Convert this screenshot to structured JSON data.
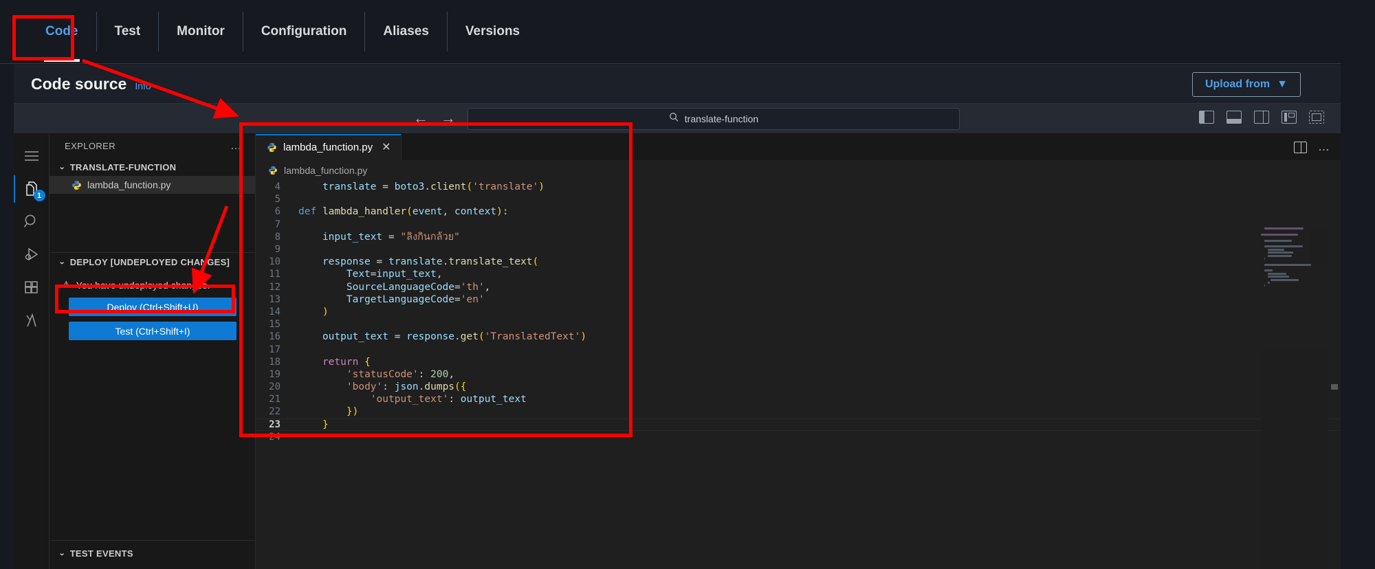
{
  "console": {
    "tabs": [
      {
        "label": "Code",
        "active": true
      },
      {
        "label": "Test",
        "active": false
      },
      {
        "label": "Monitor",
        "active": false
      },
      {
        "label": "Configuration",
        "active": false
      },
      {
        "label": "Aliases",
        "active": false
      },
      {
        "label": "Versions",
        "active": false
      }
    ],
    "section_title": "Code source",
    "info_link": "Info",
    "upload_button": "Upload from",
    "upload_caret": "▼"
  },
  "ide_toolbar": {
    "back_arrow": "←",
    "forward_arrow": "→",
    "quickopen_icon": "search-icon",
    "quickopen_value": "translate-function",
    "layout_icons": [
      "toggle-primary-sidebar-icon",
      "toggle-panel-icon",
      "toggle-secondary-sidebar-icon",
      "customize-layout-icon",
      "fullscreen-icon"
    ]
  },
  "activity_bar": {
    "items": [
      {
        "name": "menu-icon",
        "badge": ""
      },
      {
        "name": "explorer-icon",
        "badge": "1"
      },
      {
        "name": "search-icon",
        "badge": ""
      },
      {
        "name": "run-and-debug-icon",
        "badge": ""
      },
      {
        "name": "extensions-icon",
        "badge": ""
      },
      {
        "name": "lambda-icon",
        "badge": ""
      }
    ]
  },
  "explorer": {
    "title": "EXPLORER",
    "more_actions": "…",
    "project": {
      "chevron": "⌄",
      "name": "TRANSLATE-FUNCTION"
    },
    "files": [
      {
        "name": "lambda_function.py",
        "icon": "python-file-icon",
        "selected": true
      }
    ],
    "deploy": {
      "chevron": "⌄",
      "header": "DEPLOY [UNDEPLOYED CHANGES]",
      "warning_icon": "⚠",
      "warning_text": "You have undeployed changes.",
      "deploy_button": "Deploy (Ctrl+Shift+U)",
      "test_button": "Test (Ctrl+Shift+I)"
    },
    "test_events": {
      "chevron": "⌄",
      "header": "TEST EVENTS"
    }
  },
  "editor": {
    "tab": {
      "label": "lambda_function.py",
      "icon": "python-file-icon",
      "close": "✕"
    },
    "tab_actions": {
      "split_editor": "split-editor-icon",
      "more": "…"
    },
    "breadcrumb": "lambda_function.py",
    "first_visible_line": 4,
    "current_line": 23,
    "lines": [
      {
        "n": 4,
        "text": "    translate = boto3.client('translate')"
      },
      {
        "n": 5,
        "text": ""
      },
      {
        "n": 6,
        "text": "def lambda_handler(event, context):"
      },
      {
        "n": 7,
        "text": ""
      },
      {
        "n": 8,
        "text": "    input_text = \"ลิงกินกล้วย\""
      },
      {
        "n": 9,
        "text": ""
      },
      {
        "n": 10,
        "text": "    response = translate.translate_text("
      },
      {
        "n": 11,
        "text": "        Text=input_text,"
      },
      {
        "n": 12,
        "text": "        SourceLanguageCode='th',"
      },
      {
        "n": 13,
        "text": "        TargetLanguageCode='en'"
      },
      {
        "n": 14,
        "text": "    )"
      },
      {
        "n": 15,
        "text": ""
      },
      {
        "n": 16,
        "text": "    output_text = response.get('TranslatedText')"
      },
      {
        "n": 17,
        "text": ""
      },
      {
        "n": 18,
        "text": "    return {"
      },
      {
        "n": 19,
        "text": "        'statusCode': 200,"
      },
      {
        "n": 20,
        "text": "        'body': json.dumps({"
      },
      {
        "n": 21,
        "text": "            'output_text': output_text"
      },
      {
        "n": 22,
        "text": "        })"
      },
      {
        "n": 23,
        "text": "    }"
      },
      {
        "n": 24,
        "text": ""
      }
    ]
  },
  "annotations": {
    "highlight_color": "#fe0000",
    "boxes": [
      {
        "name": "code-tab-highlight"
      },
      {
        "name": "editor-panel-highlight"
      },
      {
        "name": "deploy-button-highlight"
      }
    ],
    "arrows": [
      {
        "name": "arrow-to-editor"
      },
      {
        "name": "arrow-to-deploy-button"
      }
    ]
  },
  "colors": {
    "accent_blue": "#539fe5",
    "button_blue": "#0e7ad4",
    "annotation_red": "#fe0000",
    "console_bg": "#16191f",
    "editor_bg": "#1f1f1f"
  }
}
